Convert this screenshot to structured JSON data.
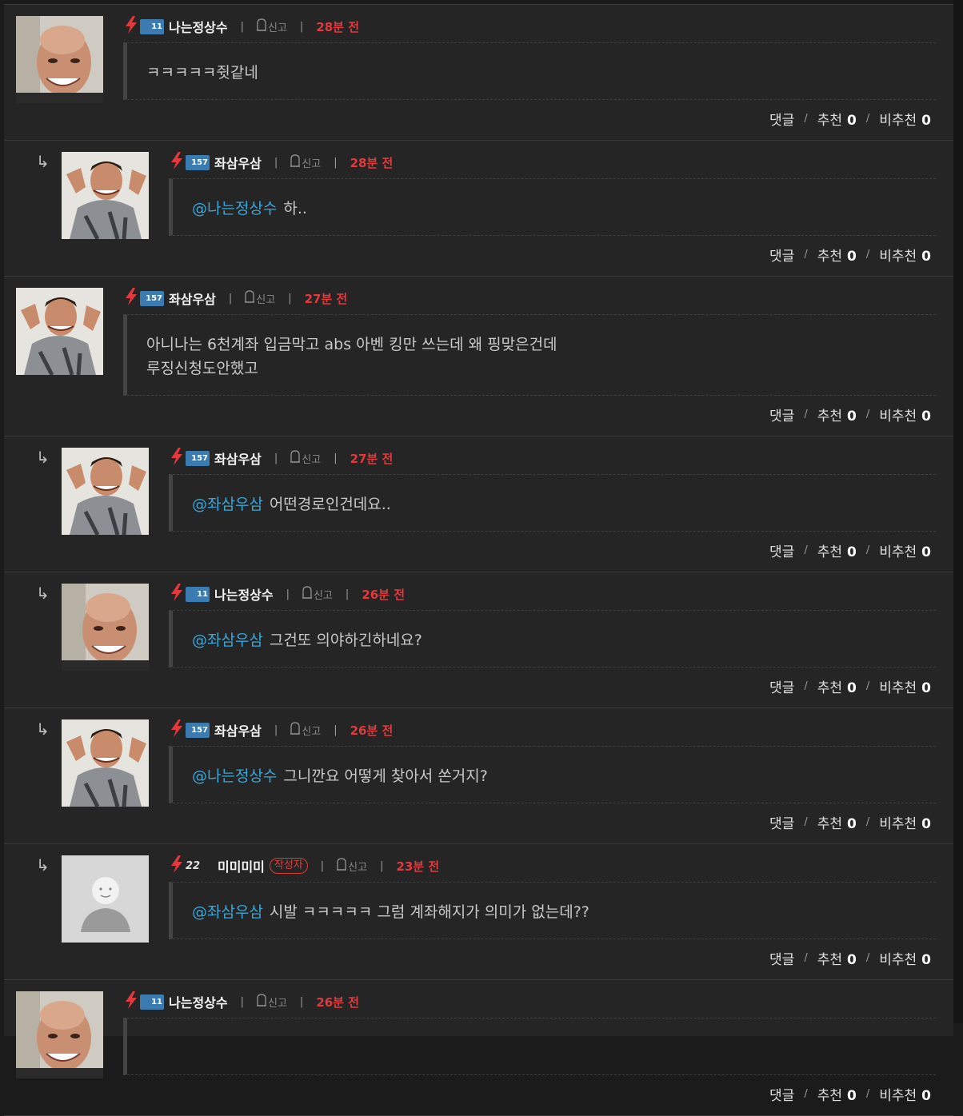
{
  "actions": {
    "reply_label": "댓글",
    "like_label": "추천",
    "dislike_label": "비추천"
  },
  "report_label": "신고",
  "comments": [
    {
      "reply": false,
      "nick": "나는정상수",
      "level": "11",
      "author": false,
      "time": "28분 전",
      "mention": "",
      "text": "ㅋㅋㅋㅋㅋ쥣같네",
      "likes": "0",
      "dislikes": "0",
      "avatar": "bald"
    },
    {
      "reply": true,
      "nick": "좌삼우삼",
      "level": "157",
      "author": false,
      "time": "28분 전",
      "mention": "@나는정상수",
      "text": "하..",
      "likes": "0",
      "dislikes": "0",
      "avatar": "pose"
    },
    {
      "reply": false,
      "nick": "좌삼우삼",
      "level": "157",
      "author": false,
      "time": "27분 전",
      "mention": "",
      "text": "아니나는 6천계좌 입금막고 abs 아벤 킹만 쓰는데 왜 핑맞은건데",
      "text2": "루징신청도안했고",
      "likes": "0",
      "dislikes": "0",
      "avatar": "pose"
    },
    {
      "reply": true,
      "nick": "좌삼우삼",
      "level": "157",
      "author": false,
      "time": "27분 전",
      "mention": "@좌삼우삼",
      "text": "어떤경로인건데요..",
      "likes": "0",
      "dislikes": "0",
      "avatar": "pose"
    },
    {
      "reply": true,
      "nick": "나는정상수",
      "level": "11",
      "author": false,
      "time": "26분 전",
      "mention": "@좌삼우삼",
      "text": "그건또 의야하긴하네요?",
      "likes": "0",
      "dislikes": "0",
      "avatar": "bald"
    },
    {
      "reply": true,
      "nick": "좌삼우삼",
      "level": "157",
      "author": false,
      "time": "26분 전",
      "mention": "@나는정상수",
      "text": "그니깐요 어떻게 찾아서 쏜거지?",
      "likes": "0",
      "dislikes": "0",
      "avatar": "pose"
    },
    {
      "reply": true,
      "nick": "미미미미",
      "level": "22",
      "author": true,
      "author_label": "작성자",
      "time": "23분 전",
      "mention": "@좌삼우삼",
      "text": "시발 ㅋㅋㅋㅋㅋ 그럼 계좌해지가 의미가 없는데??",
      "likes": "0",
      "dislikes": "0",
      "avatar": "default"
    },
    {
      "reply": false,
      "nick": "나는정상수",
      "level": "11",
      "author": false,
      "time": "26분 전",
      "mention": "",
      "text": "",
      "likes": "0",
      "dislikes": "0",
      "avatar": "bald"
    }
  ]
}
